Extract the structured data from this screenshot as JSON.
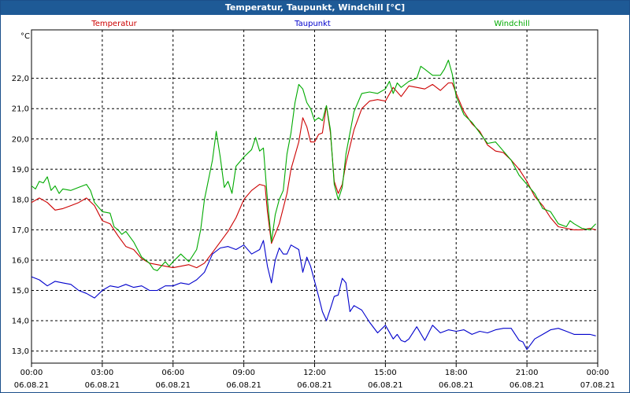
{
  "window": {
    "title": "Temperatur, Taupunkt, Windchill [°C]"
  },
  "chart_data": {
    "type": "line",
    "title": "Temperatur, Taupunkt, Windchill [°C]",
    "ylabel": "°C",
    "xlabel": "",
    "xlim": [
      0,
      24
    ],
    "ylim": [
      12.6,
      23.6
    ],
    "grid": true,
    "legend": "top",
    "y_ticks": [
      "13,0",
      "14,0",
      "15,0",
      "16,0",
      "17,0",
      "18,0",
      "19,0",
      "20,0",
      "21,0",
      "22,0"
    ],
    "x_ticks": [
      {
        "time": "00:00",
        "date": "06.08.21"
      },
      {
        "time": "03:00",
        "date": "06.08.21"
      },
      {
        "time": "06:00",
        "date": "06.08.21"
      },
      {
        "time": "09:00",
        "date": "06.08.21"
      },
      {
        "time": "12:00",
        "date": "06.08.21"
      },
      {
        "time": "15:00",
        "date": "06.08.21"
      },
      {
        "time": "18:00",
        "date": "06.08.21"
      },
      {
        "time": "21:00",
        "date": "06.08.21"
      },
      {
        "time": "00:00",
        "date": "07.08.21"
      }
    ],
    "series": [
      {
        "name": "Temperatur",
        "color": "#cc0000",
        "points": [
          [
            0,
            17.9
          ],
          [
            0.33,
            18.05
          ],
          [
            0.67,
            17.9
          ],
          [
            1,
            17.65
          ],
          [
            1.33,
            17.7
          ],
          [
            1.67,
            17.8
          ],
          [
            2,
            17.9
          ],
          [
            2.33,
            18.05
          ],
          [
            2.67,
            17.8
          ],
          [
            3,
            17.3
          ],
          [
            3.33,
            17.2
          ],
          [
            3.67,
            16.8
          ],
          [
            4,
            16.45
          ],
          [
            4.33,
            16.35
          ],
          [
            4.67,
            16.05
          ],
          [
            5,
            15.9
          ],
          [
            5.33,
            15.85
          ],
          [
            5.67,
            15.8
          ],
          [
            6,
            15.75
          ],
          [
            6.33,
            15.8
          ],
          [
            6.67,
            15.85
          ],
          [
            7,
            15.75
          ],
          [
            7.33,
            15.9
          ],
          [
            7.67,
            16.25
          ],
          [
            8,
            16.6
          ],
          [
            8.33,
            16.95
          ],
          [
            8.67,
            17.4
          ],
          [
            9,
            18.0
          ],
          [
            9.33,
            18.3
          ],
          [
            9.67,
            18.5
          ],
          [
            9.9,
            18.45
          ],
          [
            10,
            17.6
          ],
          [
            10.17,
            16.55
          ],
          [
            10.5,
            17.2
          ],
          [
            10.83,
            18.2
          ],
          [
            11,
            19.0
          ],
          [
            11.33,
            19.9
          ],
          [
            11.5,
            20.7
          ],
          [
            11.67,
            20.4
          ],
          [
            11.83,
            19.9
          ],
          [
            12,
            19.9
          ],
          [
            12.17,
            20.15
          ],
          [
            12.33,
            20.2
          ],
          [
            12.5,
            21.1
          ],
          [
            12.67,
            20.2
          ],
          [
            12.83,
            18.6
          ],
          [
            13,
            18.2
          ],
          [
            13.17,
            18.5
          ],
          [
            13.33,
            19.2
          ],
          [
            13.67,
            20.3
          ],
          [
            14,
            21.0
          ],
          [
            14.33,
            21.25
          ],
          [
            14.67,
            21.3
          ],
          [
            15,
            21.25
          ],
          [
            15.33,
            21.7
          ],
          [
            15.67,
            21.4
          ],
          [
            16,
            21.75
          ],
          [
            16.33,
            21.7
          ],
          [
            16.67,
            21.65
          ],
          [
            17,
            21.8
          ],
          [
            17.33,
            21.6
          ],
          [
            17.67,
            21.85
          ],
          [
            17.83,
            21.85
          ],
          [
            18,
            21.5
          ],
          [
            18.33,
            20.9
          ],
          [
            18.67,
            20.5
          ],
          [
            19,
            20.25
          ],
          [
            19.33,
            19.8
          ],
          [
            19.67,
            19.6
          ],
          [
            20,
            19.55
          ],
          [
            20.33,
            19.3
          ],
          [
            20.67,
            19.0
          ],
          [
            21,
            18.6
          ],
          [
            21.33,
            18.1
          ],
          [
            21.67,
            17.8
          ],
          [
            22,
            17.4
          ],
          [
            22.33,
            17.1
          ],
          [
            22.67,
            17.05
          ],
          [
            23,
            17.0
          ],
          [
            23.33,
            17.0
          ],
          [
            23.67,
            17.05
          ],
          [
            23.92,
            17.0
          ]
        ]
      },
      {
        "name": "Taupunkt",
        "color": "#0000cc",
        "points": [
          [
            0,
            15.45
          ],
          [
            0.33,
            15.35
          ],
          [
            0.67,
            15.15
          ],
          [
            1,
            15.3
          ],
          [
            1.33,
            15.25
          ],
          [
            1.67,
            15.2
          ],
          [
            2,
            15.0
          ],
          [
            2.33,
            14.9
          ],
          [
            2.67,
            14.75
          ],
          [
            3,
            15.0
          ],
          [
            3.33,
            15.15
          ],
          [
            3.67,
            15.1
          ],
          [
            4,
            15.2
          ],
          [
            4.33,
            15.1
          ],
          [
            4.67,
            15.15
          ],
          [
            5,
            15.0
          ],
          [
            5.33,
            15.0
          ],
          [
            5.67,
            15.15
          ],
          [
            6,
            15.15
          ],
          [
            6.33,
            15.25
          ],
          [
            6.67,
            15.2
          ],
          [
            7,
            15.35
          ],
          [
            7.33,
            15.6
          ],
          [
            7.67,
            16.2
          ],
          [
            8,
            16.4
          ],
          [
            8.33,
            16.45
          ],
          [
            8.67,
            16.35
          ],
          [
            9,
            16.5
          ],
          [
            9.33,
            16.2
          ],
          [
            9.67,
            16.35
          ],
          [
            9.83,
            16.65
          ],
          [
            10,
            15.8
          ],
          [
            10.17,
            15.25
          ],
          [
            10.33,
            16.0
          ],
          [
            10.5,
            16.4
          ],
          [
            10.67,
            16.2
          ],
          [
            10.83,
            16.2
          ],
          [
            11,
            16.5
          ],
          [
            11.33,
            16.35
          ],
          [
            11.5,
            15.6
          ],
          [
            11.67,
            16.1
          ],
          [
            11.83,
            15.8
          ],
          [
            12,
            15.3
          ],
          [
            12.17,
            14.8
          ],
          [
            12.33,
            14.3
          ],
          [
            12.5,
            14.0
          ],
          [
            12.67,
            14.4
          ],
          [
            12.83,
            14.8
          ],
          [
            13,
            14.85
          ],
          [
            13.17,
            15.4
          ],
          [
            13.33,
            15.25
          ],
          [
            13.5,
            14.3
          ],
          [
            13.67,
            14.5
          ],
          [
            14,
            14.35
          ],
          [
            14.33,
            13.95
          ],
          [
            14.67,
            13.6
          ],
          [
            15,
            13.85
          ],
          [
            15.33,
            13.4
          ],
          [
            15.5,
            13.55
          ],
          [
            15.67,
            13.35
          ],
          [
            15.83,
            13.3
          ],
          [
            16,
            13.4
          ],
          [
            16.33,
            13.8
          ],
          [
            16.67,
            13.35
          ],
          [
            17,
            13.85
          ],
          [
            17.33,
            13.6
          ],
          [
            17.67,
            13.7
          ],
          [
            18,
            13.65
          ],
          [
            18.33,
            13.7
          ],
          [
            18.67,
            13.55
          ],
          [
            19,
            13.65
          ],
          [
            19.33,
            13.6
          ],
          [
            19.67,
            13.7
          ],
          [
            20,
            13.75
          ],
          [
            20.33,
            13.75
          ],
          [
            20.67,
            13.35
          ],
          [
            20.83,
            13.3
          ],
          [
            21,
            13.05
          ],
          [
            21.33,
            13.4
          ],
          [
            21.67,
            13.55
          ],
          [
            22,
            13.7
          ],
          [
            22.33,
            13.75
          ],
          [
            22.67,
            13.65
          ],
          [
            23,
            13.55
          ],
          [
            23.33,
            13.55
          ],
          [
            23.67,
            13.55
          ],
          [
            23.92,
            13.5
          ]
        ]
      },
      {
        "name": "Windchill",
        "color": "#00aa00",
        "points": [
          [
            0,
            18.45
          ],
          [
            0.17,
            18.35
          ],
          [
            0.33,
            18.6
          ],
          [
            0.5,
            18.55
          ],
          [
            0.67,
            18.75
          ],
          [
            0.83,
            18.3
          ],
          [
            1,
            18.45
          ],
          [
            1.17,
            18.2
          ],
          [
            1.33,
            18.35
          ],
          [
            1.67,
            18.3
          ],
          [
            2,
            18.4
          ],
          [
            2.33,
            18.5
          ],
          [
            2.5,
            18.3
          ],
          [
            2.67,
            17.9
          ],
          [
            3,
            17.6
          ],
          [
            3.33,
            17.55
          ],
          [
            3.5,
            17.1
          ],
          [
            3.67,
            17.0
          ],
          [
            3.83,
            16.85
          ],
          [
            4,
            16.95
          ],
          [
            4.33,
            16.6
          ],
          [
            4.67,
            16.1
          ],
          [
            5,
            15.9
          ],
          [
            5.17,
            15.7
          ],
          [
            5.33,
            15.65
          ],
          [
            5.67,
            15.95
          ],
          [
            5.83,
            15.8
          ],
          [
            6,
            15.95
          ],
          [
            6.33,
            16.2
          ],
          [
            6.67,
            15.95
          ],
          [
            7,
            16.35
          ],
          [
            7.17,
            17.0
          ],
          [
            7.33,
            18.0
          ],
          [
            7.67,
            19.3
          ],
          [
            7.83,
            20.25
          ],
          [
            8,
            19.4
          ],
          [
            8.17,
            18.4
          ],
          [
            8.33,
            18.6
          ],
          [
            8.5,
            18.2
          ],
          [
            8.67,
            19.1
          ],
          [
            9,
            19.4
          ],
          [
            9.33,
            19.65
          ],
          [
            9.5,
            20.05
          ],
          [
            9.67,
            19.6
          ],
          [
            9.83,
            19.7
          ],
          [
            10,
            18.0
          ],
          [
            10.17,
            16.6
          ],
          [
            10.33,
            17.5
          ],
          [
            10.5,
            18.0
          ],
          [
            10.67,
            18.3
          ],
          [
            10.83,
            19.5
          ],
          [
            11,
            20.2
          ],
          [
            11.17,
            21.2
          ],
          [
            11.33,
            21.8
          ],
          [
            11.5,
            21.65
          ],
          [
            11.67,
            21.2
          ],
          [
            11.83,
            21.0
          ],
          [
            12,
            20.6
          ],
          [
            12.17,
            20.7
          ],
          [
            12.33,
            20.6
          ],
          [
            12.5,
            21.1
          ],
          [
            12.67,
            20.3
          ],
          [
            12.83,
            18.5
          ],
          [
            13,
            18.0
          ],
          [
            13.17,
            18.4
          ],
          [
            13.33,
            19.5
          ],
          [
            13.67,
            20.9
          ],
          [
            14,
            21.5
          ],
          [
            14.33,
            21.55
          ],
          [
            14.67,
            21.5
          ],
          [
            15,
            21.65
          ],
          [
            15.17,
            21.9
          ],
          [
            15.33,
            21.5
          ],
          [
            15.5,
            21.85
          ],
          [
            15.67,
            21.7
          ],
          [
            16,
            21.9
          ],
          [
            16.33,
            22.0
          ],
          [
            16.5,
            22.4
          ],
          [
            16.67,
            22.3
          ],
          [
            17,
            22.1
          ],
          [
            17.33,
            22.1
          ],
          [
            17.5,
            22.3
          ],
          [
            17.67,
            22.6
          ],
          [
            17.83,
            22.15
          ],
          [
            18,
            21.4
          ],
          [
            18.33,
            20.8
          ],
          [
            18.67,
            20.55
          ],
          [
            19,
            20.2
          ],
          [
            19.33,
            19.85
          ],
          [
            19.67,
            19.9
          ],
          [
            20,
            19.6
          ],
          [
            20.33,
            19.3
          ],
          [
            20.67,
            18.8
          ],
          [
            21,
            18.5
          ],
          [
            21.33,
            18.2
          ],
          [
            21.67,
            17.7
          ],
          [
            22,
            17.6
          ],
          [
            22.33,
            17.2
          ],
          [
            22.67,
            17.1
          ],
          [
            22.83,
            17.3
          ],
          [
            23,
            17.2
          ],
          [
            23.33,
            17.05
          ],
          [
            23.67,
            17.0
          ],
          [
            23.92,
            17.2
          ]
        ]
      }
    ]
  }
}
